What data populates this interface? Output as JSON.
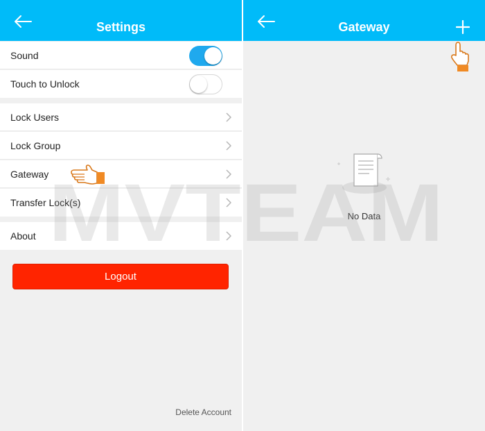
{
  "settings": {
    "title": "Settings",
    "rows": [
      {
        "label": "Sound"
      },
      {
        "label": "Touch to Unlock"
      },
      {
        "label": "Lock Users"
      },
      {
        "label": "Lock Group"
      },
      {
        "label": "Gateway"
      },
      {
        "label": "Transfer Lock(s)"
      },
      {
        "label": "About"
      }
    ],
    "toggles": {
      "sound": "on",
      "touch_to_unlock": "off"
    },
    "logout_label": "Logout",
    "delete_account_label": "Delete Account"
  },
  "gateway": {
    "title": "Gateway",
    "empty_text": "No Data"
  },
  "watermark": {
    "text": "MVTEAM"
  },
  "colors": {
    "header": "#00bbf9",
    "toggle_on": "#1fa9ee",
    "logout": "#ff2400",
    "background": "#f0f0f0",
    "hand_cursor": "#f08a24"
  },
  "icons": {
    "back": "arrow-left-icon",
    "chevron": "chevron-right-icon",
    "add": "plus-icon",
    "empty": "empty-document-icon",
    "pointer": "pointing-hand-icon"
  }
}
